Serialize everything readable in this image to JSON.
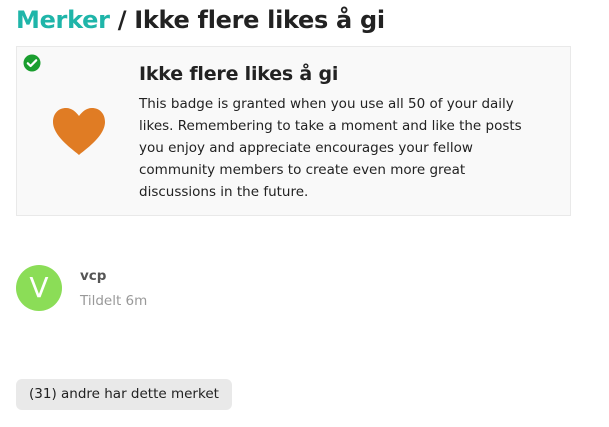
{
  "breadcrumb": {
    "parent_label": "Merker",
    "separator": " / ",
    "current_label": "Ikke flere likes å gi"
  },
  "badge": {
    "name": "Ikke flere likes å gi",
    "description": "This badge is granted when you use all 50 of your daily likes. Remembering to take a moment and like the posts you enjoy and appreciate encourages your fellow community members to create even more great discussions in the future.",
    "icon": "heart-icon",
    "icon_color": "#e07c24",
    "granted_icon": "check-circle-icon",
    "granted_icon_color": "#1a9e2f"
  },
  "grantee": {
    "avatar_letter": "V",
    "avatar_color": "#8bdd57",
    "username": "vcp",
    "granted_text": "Tildelt 6m"
  },
  "others": {
    "label": "(31) andre har dette merket"
  },
  "colors": {
    "link": "#1fb5a9",
    "card_background": "#f9f9f9",
    "button_background": "#e9e9e9"
  }
}
